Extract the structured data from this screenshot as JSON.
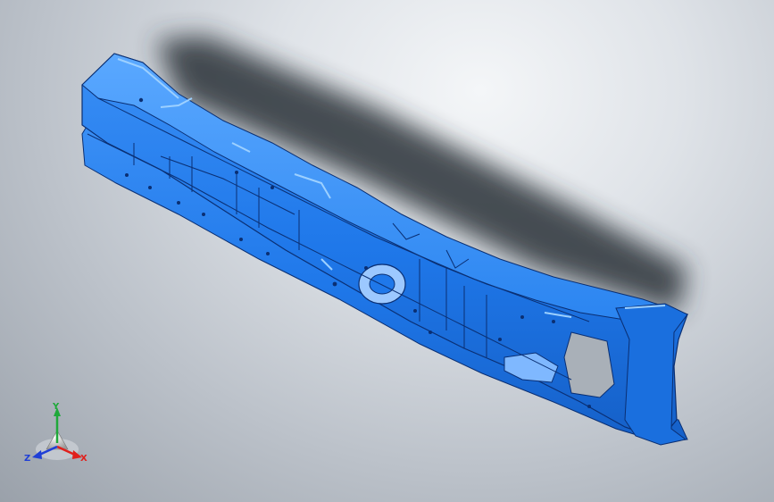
{
  "viewport": {
    "background_top": "#f4f6f8",
    "background_bottom": "#9aa1aa"
  },
  "model": {
    "color": "#1f78ea",
    "highlight": "#6fb4ff",
    "edge": "#0a2f73",
    "shadow": "#2b3038"
  },
  "triad": {
    "x_label": "X",
    "y_label": "Y",
    "z_label": "Z",
    "x_color": "#e0201c",
    "y_color": "#1fa83a",
    "z_color": "#1f3fd6"
  }
}
